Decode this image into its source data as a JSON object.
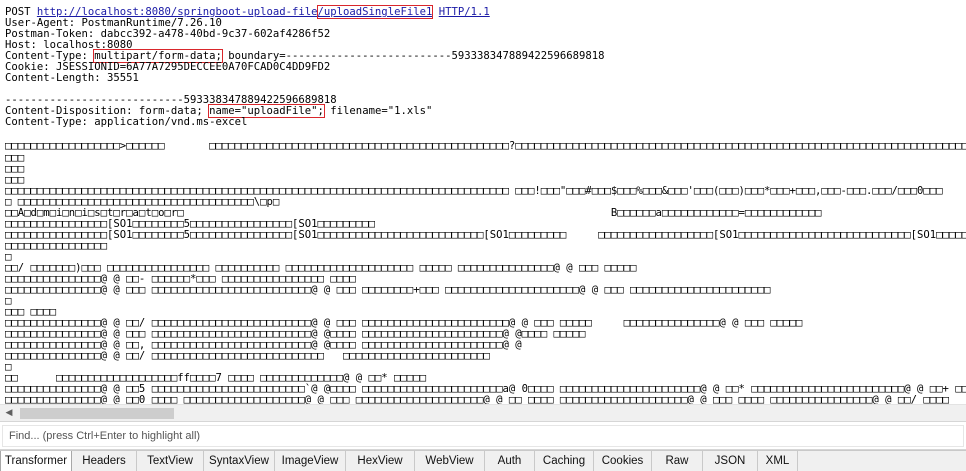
{
  "raw": {
    "lines": [
      {
        "segments": [
          {
            "t": "POST "
          },
          {
            "t": "http://localhost:8080/springboot-upload-file",
            "link": true
          },
          {
            "t": "/uploadSingleFile1",
            "link": true,
            "hl": true
          },
          {
            "t": " "
          },
          {
            "t": "HTTP/1.1",
            "link": true
          }
        ]
      },
      {
        "segments": [
          {
            "t": "User-Agent: PostmanRuntime/7.26.10"
          }
        ]
      },
      {
        "segments": [
          {
            "t": "Postman-Token: dabcc392-a478-40bd-9c37-602af4286f52"
          }
        ]
      },
      {
        "segments": [
          {
            "t": "Host: localhost:8080"
          }
        ]
      },
      {
        "segments": [
          {
            "t": "Content-Type: "
          },
          {
            "t": "multipart/form-data;",
            "hl": true
          },
          {
            "t": " boundary=--------------------------593338347889422596689818"
          }
        ]
      },
      {
        "segments": [
          {
            "t": "Cookie: JSESSIONID=6A77A7295DECCEE0A70FCAD0C4DD9FD2"
          }
        ]
      },
      {
        "segments": [
          {
            "t": "Content-Length: 35551"
          }
        ]
      },
      {
        "segments": [
          {
            "t": ""
          }
        ]
      },
      {
        "segments": [
          {
            "t": "----------------------------593338347889422596689818"
          }
        ]
      },
      {
        "segments": [
          {
            "t": "Content-Disposition: form-data; "
          },
          {
            "t": "name=\"uploadFile\";",
            "hl": true
          },
          {
            "t": " filename=\"1.xls\""
          }
        ]
      },
      {
        "segments": [
          {
            "t": "Content-Type: application/vnd.ms-excel"
          }
        ]
      },
      {
        "segments": [
          {
            "t": ""
          }
        ]
      },
      {
        "segments": [
          {
            "t": "□□□□□□□□□□□□□□□□□□>□□□□□□       □□□□□□□□□□□□□□□□□□□□□□□□□□□□□□□□□□□□□□□□□□□□□□□?□□□□□□□□□□□□□□□□□□□□□□□□□□□□□□□□□□□□□□□□□□□□□□□□□□□□□□□□□□□□□□□□□□□□□□□□"
          }
        ]
      },
      {
        "segments": [
          {
            "t": "□□□"
          }
        ]
      },
      {
        "segments": [
          {
            "t": "□□□"
          }
        ]
      },
      {
        "segments": [
          {
            "t": "□□□"
          }
        ]
      },
      {
        "segments": [
          {
            "t": "□□□□□□□□□□□□□□□□□□□□□□□□□□□□□□□□□□□□□□□□□□□□□□□□□□□□□□□□□□□□□□□□□□□□□□□□□□□□□□□ □□□!□□□\"□□□#□□□$□□□%□□□&□□□'□□□(□□□)□□□*□□□+□□□,□□□-□□□.□□□/□□□0□□□"
          }
        ]
      },
      {
        "segments": [
          {
            "t": "□ □□□□□□□□□□□□□□□□□□□□□□□□□□□□□□□□□□□□□\\□p□"
          }
        ]
      },
      {
        "segments": [
          {
            "t": "□□A□d□m□i□n□i□s□t□r□a□t□o□r□                                                                   B□□□□□□a□□□□□□□□□□□□=□□□□□□□□□□□□"
          }
        ]
      },
      {
        "segments": [
          {
            "t": "□□□□□□□□□□□□□□□□[SO1□□□□□□□□5□□□□□□□□□□□□□□□□[SO1□□□□□□□□□"
          }
        ]
      },
      {
        "segments": [
          {
            "t": "□□□□□□□□□□□□□□□□[SO1□□□□□□□□5□□□□□□□□□□□□□□□□[SO1□□□□□□□□□□□□□□□□□□□□□□□□□□[SO1□□□□□□□□□     □□□□□□□□□□□□□□□□□□[SO1□□□□□□□□□□□□□□□□□□□□□□□□□□□[SO1□□□□□□□□□□□□□□□□□□□□□□□□□□□□□[S"
          }
        ]
      },
      {
        "segments": [
          {
            "t": "□□□□□□□□□□□□□□□□"
          }
        ]
      },
      {
        "segments": [
          {
            "t": "□"
          }
        ]
      },
      {
        "segments": [
          {
            "t": "□□/ □□□□□□□)□□□ □□□□□□□□□□□□□□□□ □□□□□□□□□□ □□□□□□□□□□□□□□□□□□□□ □□□□□ □□□□□□□□□□□□□□□@ @ □□□ □□□□□"
          }
        ]
      },
      {
        "segments": [
          {
            "t": "□□□□□□□□□□□□□□□@ @ □□- □□□□□□*□□□ □□□□□□□□□□□□□□□□ □□□□"
          }
        ]
      },
      {
        "segments": [
          {
            "t": "□□□□□□□□□□□□□□□@ @ □□□ □□□□□□□□□□□□□□□□□□□□□□□□□@ @ □□□ □□□□□□□□+□□□ □□□□□□□□□□□□□□□□□□□□□@ @ □□□ □□□□□□□□□□□□□□□□□□□□□□"
          }
        ]
      },
      {
        "segments": [
          {
            "t": "□"
          }
        ]
      },
      {
        "segments": [
          {
            "t": "□□□ □□□□"
          }
        ]
      },
      {
        "segments": [
          {
            "t": "□□□□□□□□□□□□□□□@ @ □□/ □□□□□□□□□□□□□□□□□□□□□□□□□@ @ □□□ □□□□□□□□□□□□□□□□□□□□□□□@ @ □□□ □□□□□     □□□□□□□□□□□□□□□@ @ □□□ □□□□□"
          }
        ]
      },
      {
        "segments": [
          {
            "t": "□□□□□□□□□□□□□□□@ @ □□□ □□□□□□□□□□□□□□□□□□□□□□□□□@ @□□□□ □□□□□□□□□□□□□□□□□□□□□□@ @□□□□ □□□□□"
          }
        ]
      },
      {
        "segments": [
          {
            "t": "□□□□□□□□□□□□□□□@ @ □□, □□□□□□□□□□□□□□□□□□□□□□□□□@ @□□□□ □□□□□□□□□□□□□□□□□□□□□□@ @"
          }
        ]
      },
      {
        "segments": [
          {
            "t": "□□□□□□□□□□□□□□□@ @ □□/ □□□□□□□□□□□□□□□□□□□□□□□□□□□   □□□□□□□□□□□□□□□□□□□□□□□"
          }
        ]
      },
      {
        "segments": [
          {
            "t": "□"
          }
        ]
      },
      {
        "segments": [
          {
            "t": "□□      □□□□□□□□□□□□□□□□□□□ff□□□□7 □□□□ □□□□□□□□□□□□□@ @ □□* □□□□□"
          }
        ]
      },
      {
        "segments": [
          {
            "t": "□□□□□□□□□□□□□□□@ @ □□5 □□□□□□□□□□□□□□□□□□□□□□□□`@ @□□□□ □□□□□□□□□□□□□□□□□□□□□□a@ 0□□□□ □□□□□□□□□□□□□□□□□□□□□□@ @ □□* □□□□□□□□□□□□□□□□□□□□□□□□@ @ □□+ □□□□ □□□□□□□□□□□□□□□□□□□□@ @ □□"
          }
        ]
      },
      {
        "segments": [
          {
            "t": "□□□□□□□□□□□□□□□@ @ □□0 □□□□ □□□□□□□□□□□□□□□□□□□@ @ □□□ □□□□□□□□□□□□□□□□□□□□@ @ □□ □□□□ □□□□□□□□□□□□□□□□□□□□@ @ □□□ □□□□ □□□□□□□□□□□□□□□□@ @ □□/ □□□□"
          }
        ]
      }
    ]
  },
  "find": {
    "placeholder": "Find... (press Ctrl+Enter to highlight all)"
  },
  "tabs": [
    {
      "label": "Transformer",
      "active": true
    },
    {
      "label": "Headers"
    },
    {
      "label": "TextView"
    },
    {
      "label": "SyntaxView"
    },
    {
      "label": "ImageView"
    },
    {
      "label": "HexView"
    },
    {
      "label": "WebView"
    },
    {
      "label": "Auth"
    },
    {
      "label": "Caching"
    },
    {
      "label": "Cookies"
    },
    {
      "label": "Raw"
    },
    {
      "label": "JSON"
    },
    {
      "label": "XML"
    }
  ],
  "colors": {
    "highlight": "#d9262b",
    "link": "#1a1aa6"
  },
  "icons": {
    "scroll_left": "chevron-left-icon"
  }
}
